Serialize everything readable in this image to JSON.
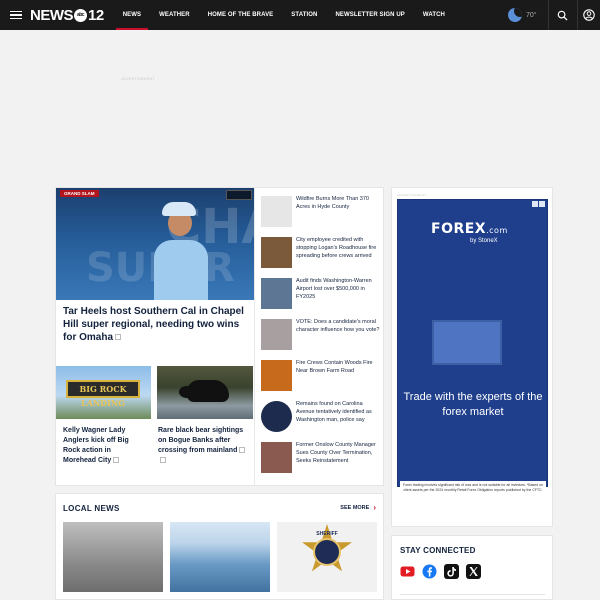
{
  "header": {
    "logo": "NEWS",
    "logo_number": "12",
    "logo_network": "abc",
    "nav": [
      {
        "label": "NEWS",
        "active": true
      },
      {
        "label": "WEATHER",
        "active": false
      },
      {
        "label": "HOME OF THE BRAVE",
        "active": false
      },
      {
        "label": "STATION",
        "active": false
      },
      {
        "label": "NEWSLETTER SIGN UP",
        "active": false
      },
      {
        "label": "WATCH",
        "active": false
      }
    ],
    "temperature": "70°",
    "weather_icon": "moon-icon",
    "accent_color": "#c8102e"
  },
  "ad_top": {
    "label": "ADVERTISEMENT"
  },
  "top_story": {
    "headline": "Tar Heels host Southern Cal in Chapel Hill super regional, needing two wins for Omaha",
    "image_tag": "GRAND SLAM"
  },
  "secondary_stories": [
    {
      "headline": "Kelly Wagner Lady Anglers kick off Big Rock action in Morehead City",
      "image_text": "BIG ROCK LANDING"
    },
    {
      "headline": "Rare black bear sightings on Bogue Banks after crossing from mainland"
    }
  ],
  "headline_list": [
    {
      "headline": "Wildfire Burns More Than 370 Acres in Hyde County",
      "thumb_color": "#e6e6e6"
    },
    {
      "headline": "City employee credited with stopping Logan's Roadhouse fire spreading before crews arrived",
      "thumb_color": "#7a5a3a"
    },
    {
      "headline": "Audit finds Washington-Warren Airport lost over $500,000 in FY2025",
      "thumb_color": "#5c7694"
    },
    {
      "headline": "VOTE: Does a candidate's moral character influence how you vote?",
      "thumb_color": "#a8a0a0"
    },
    {
      "headline": "Fire Crews Contain Woods Fire Near Brown Farm Road",
      "thumb_color": "#c86a1c"
    },
    {
      "headline": "Remains found on Carolina Avenue tentatively identified as Washington man, police say",
      "thumb_color": "#1d2b4e"
    },
    {
      "headline": "Former Onslow County Manager Sues County Over Termination, Seeks Reinstatement",
      "thumb_color": "#8a5a50"
    }
  ],
  "ad_side": {
    "label": "ADVERTISEMENT",
    "brand": "FOREX",
    "brand_suffix": ".com",
    "brand_sub": "by StoneX",
    "tagline": "Trade with the experts of the forex market",
    "disclaimer": "Forex trading involves significant risk of loss and is not suitable for all investors. *Based on client assets per the 2024 monthly Retail Forex Obligation reports published by the CFTC."
  },
  "local_news": {
    "title": "LOCAL NEWS",
    "see_more": "SEE MORE",
    "badge_text": "SHERIFF",
    "badge_sub": "PITT COUNTY"
  },
  "stay_connected": {
    "title": "STAY CONNECTED",
    "socials": [
      "youtube-icon",
      "facebook-icon",
      "tiktok-icon",
      "x-icon"
    ]
  }
}
